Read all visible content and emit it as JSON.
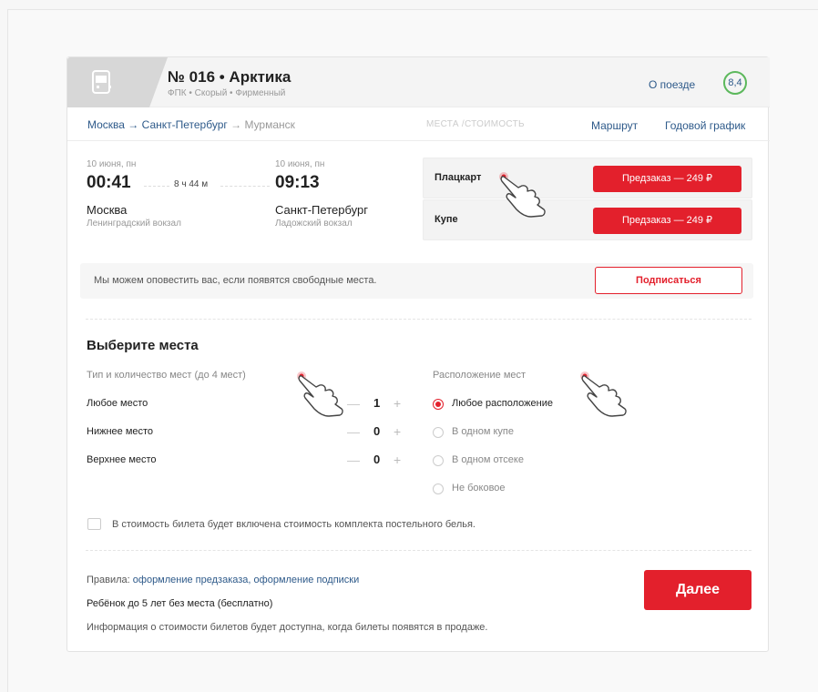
{
  "train": {
    "title": "№ 016 • Арктика",
    "subtitle": "ФПК • Скорый • Фирменный",
    "about_label": "О поезде",
    "rating": "8,4"
  },
  "route": {
    "from": "Москва",
    "arrow1": " → ",
    "to": "Санкт-Петербург",
    "arrow2": " → ",
    "final": "Мурманск"
  },
  "tabs": {
    "seats_price": "МЕСТА /СТОИМОСТЬ",
    "route": "Маршрут",
    "schedule": "Годовой график"
  },
  "trip": {
    "departure": {
      "date": "10 июня, пн",
      "time": "00:41",
      "city": "Москва",
      "station": "Ленинградский вокзал"
    },
    "duration": "8 ч 44 м",
    "arrival": {
      "date": "10 июня, пн",
      "time": "09:13",
      "city": "Санкт-Петербург",
      "station": "Ладожский  вокзал"
    }
  },
  "classes": [
    {
      "name": "Плацкарт",
      "button": "Предзаказ — 249 ₽"
    },
    {
      "name": "Купе",
      "button": "Предзаказ — 249 ₽"
    }
  ],
  "notify": {
    "text": "Мы можем оповестить вас, если появятся свободные места.",
    "button": "Подписаться"
  },
  "seats": {
    "title": "Выберите места",
    "type_label": "Тип и количество мест (до 4 мест)",
    "location_label": "Расположение мест",
    "types": [
      {
        "label": "Любое место",
        "count": "1"
      },
      {
        "label": "Нижнее место",
        "count": "0"
      },
      {
        "label": "Верхнее место",
        "count": "0"
      }
    ],
    "plus": "+",
    "locations": [
      {
        "label": "Любое расположение",
        "selected": true
      },
      {
        "label": "В одном купе",
        "selected": false
      },
      {
        "label": "В одном отсеке",
        "selected": false
      },
      {
        "label": "Не боковое",
        "selected": false
      }
    ]
  },
  "bedding": {
    "label": "В стоимость билета будет включена стоимость комплекта постельного белья.",
    "checked": false
  },
  "footer": {
    "rules_prefix": "Правила: ",
    "rule1": "оформление предзаказа",
    "rules_sep": ", ",
    "rule2": "оформление подписки",
    "child": "Ребёнок до 5 лет без места (бесплатно)",
    "info": "Информация о стоимости билетов будет доступна, когда билеты появятся в продаже.",
    "next": "Далее"
  },
  "colors": {
    "accent": "#e3202c",
    "link": "#2e5a8a",
    "rating_ring": "#5cb85c"
  }
}
